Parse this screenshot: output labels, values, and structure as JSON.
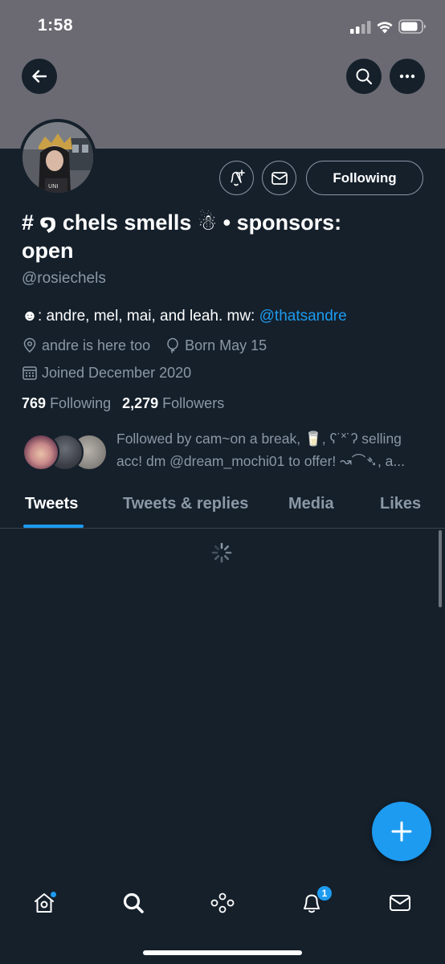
{
  "status_bar": {
    "time": "1:58"
  },
  "profile": {
    "display_name": "# ໑ chels smells ☃︎ • sponsors: open",
    "handle": "@rosiechels",
    "bio_text": "☻: andre, mel, mai, and leah. mw: ",
    "bio_mention": "@thatsandre",
    "location": "andre is here too",
    "birthday": "Born May 15",
    "joined": "Joined December 2020",
    "following_count": "769",
    "following_label": "Following",
    "followers_count": "2,279",
    "followers_label": "Followers",
    "followed_by": "Followed by cam~on a break, 🥛, ʕ˙˟˙ʔ selling acc! dm @dream_mochi01 to offer! ↝⌒➴, a..."
  },
  "actions": {
    "following_button": "Following"
  },
  "tabs": [
    {
      "label": "Tweets",
      "active": true
    },
    {
      "label": "Tweets & replies",
      "active": false
    },
    {
      "label": "Media",
      "active": false
    },
    {
      "label": "Likes",
      "active": false
    }
  ],
  "bottom_nav": {
    "items": [
      "home-icon",
      "search-icon",
      "spaces-icon",
      "notifications-icon",
      "messages-icon"
    ],
    "notification_badge": "1"
  },
  "colors": {
    "background": "#15202b",
    "banner": "#6b6a72",
    "accent": "#1d9bf0",
    "secondary_text": "#8b98a5"
  }
}
